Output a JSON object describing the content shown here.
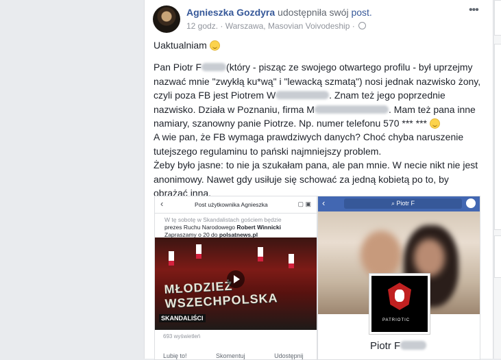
{
  "post": {
    "author": "Agnieszka Gozdyra",
    "action": "udostępniła swój",
    "post_link": "post.",
    "time": "12 godz.",
    "separator": "·",
    "location": "Warszawa, Masovian Voivodeship",
    "sep2": "·",
    "more": "•••",
    "updated": "Uaktualniam",
    "lines": [
      {
        "a": "Pan Piotr F",
        "b": "(który - pisząc ze swojego otwartego profilu - był uprzejmy nazwać mnie \"zwykłą ku*wą\" i \"lewacką szmatą\") nosi jednak nazwisko żony, czyli poza FB jest Piotrem W",
        "c": ". Znam też jego poprzednie nazwisko. Działa w Poznaniu, firma M",
        "d": ". Mam też pana inne namiary, szanowny panie Piotrze. Np. numer telefonu 570 *** ***"
      },
      {
        "text": "A wie pan, że FB wymaga prawdziwych danych? Choć chyba naruszenie tutejszego regulaminu to pański najmniejszy problem."
      },
      {
        "text": "Żeby było jasne: to nie ja szukałam pana, ale pan mnie. W necie nikt nie jest anonimowy. Nawet gdy usiłuje się schować za jedną kobietą po to, by obrażać inną."
      }
    ]
  },
  "screenshot_left": {
    "header_title": "Post użytkownika Agnieszka",
    "back": "‹",
    "snippet_line1": "W tę sobotę w Skandalistach gościem będzie",
    "snippet_line2_a": "prezes Ruchu Narodowego ",
    "snippet_line2_b": "Robert Winnicki",
    "snippet_line3_a": "Zapraszamy o 20 do ",
    "snippet_line3_b": "polsatnews.pl",
    "video_text": "MŁODZIEŻ WSZECHPOLSKA",
    "show_label": "SKANDALIŚCI",
    "views": "693 wyświetleń",
    "like": "Lubię to!",
    "comment": "Skomentuj",
    "share": "Udostępnij"
  },
  "screenshot_right": {
    "back": "‹",
    "search_text": "Piotr F",
    "profile_badge_text": "PATRIOTIC",
    "profile_name": "Piotr F"
  },
  "colors": {
    "link": "#365899",
    "fb_blue": "#4267b2",
    "meta": "#90949c"
  }
}
